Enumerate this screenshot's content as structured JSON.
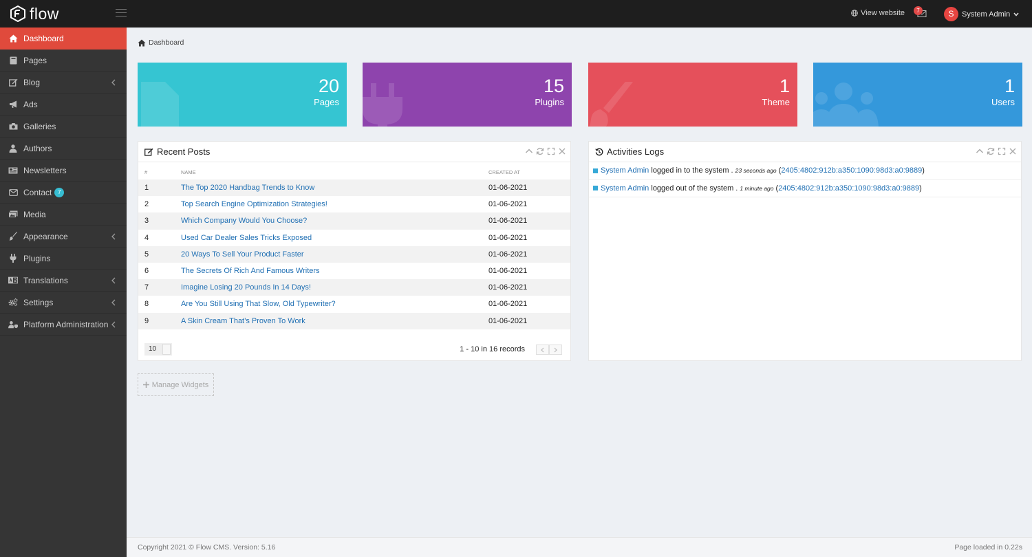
{
  "brand": {
    "name": "flow"
  },
  "topbar": {
    "view_website": "View website",
    "mail_badge": "7",
    "user_initial": "S",
    "user_name": "System Admin"
  },
  "sidebar": {
    "items": [
      {
        "label": "Dashboard",
        "icon": "home-icon",
        "active": true
      },
      {
        "label": "Pages",
        "icon": "book-icon"
      },
      {
        "label": "Blog",
        "icon": "edit-icon",
        "has_children": true
      },
      {
        "label": "Ads",
        "icon": "bullhorn-icon"
      },
      {
        "label": "Galleries",
        "icon": "camera-icon"
      },
      {
        "label": "Authors",
        "icon": "user-tie-icon"
      },
      {
        "label": "Newsletters",
        "icon": "newspaper-icon"
      },
      {
        "label": "Contact",
        "icon": "envelope-icon",
        "badge": "7"
      },
      {
        "label": "Media",
        "icon": "images-icon"
      },
      {
        "label": "Appearance",
        "icon": "paint-brush-icon",
        "has_children": true
      },
      {
        "label": "Plugins",
        "icon": "plug-icon"
      },
      {
        "label": "Translations",
        "icon": "language-icon",
        "has_children": true
      },
      {
        "label": "Settings",
        "icon": "cogs-icon",
        "has_children": true
      },
      {
        "label": "Platform Administration",
        "icon": "user-shield-icon",
        "has_children": true
      }
    ]
  },
  "breadcrumb": {
    "current": "Dashboard"
  },
  "stats": [
    {
      "value": "20",
      "label": "Pages",
      "color": "#35c5d2"
    },
    {
      "value": "15",
      "label": "Plugins",
      "color": "#8e44ad"
    },
    {
      "value": "1",
      "label": "Theme",
      "color": "#e5505b"
    },
    {
      "value": "1",
      "label": "Users",
      "color": "#3498db"
    }
  ],
  "recent_posts": {
    "title": "Recent Posts",
    "columns": [
      "#",
      "NAME",
      "CREATED AT"
    ],
    "rows": [
      {
        "num": "1",
        "name": "The Top 2020 Handbag Trends to Know",
        "date": "01-06-2021"
      },
      {
        "num": "2",
        "name": "Top Search Engine Optimization Strategies!",
        "date": "01-06-2021"
      },
      {
        "num": "3",
        "name": "Which Company Would You Choose?",
        "date": "01-06-2021"
      },
      {
        "num": "4",
        "name": "Used Car Dealer Sales Tricks Exposed",
        "date": "01-06-2021"
      },
      {
        "num": "5",
        "name": "20 Ways To Sell Your Product Faster",
        "date": "01-06-2021"
      },
      {
        "num": "6",
        "name": "The Secrets Of Rich And Famous Writers",
        "date": "01-06-2021"
      },
      {
        "num": "7",
        "name": "Imagine Losing 20 Pounds In 14 Days!",
        "date": "01-06-2021"
      },
      {
        "num": "8",
        "name": "Are You Still Using That Slow, Old Typewriter?",
        "date": "01-06-2021"
      },
      {
        "num": "9",
        "name": "A Skin Cream That’s Proven To Work",
        "date": "01-06-2021"
      }
    ],
    "page_size": "10",
    "records": "1 - 10 in 16 records"
  },
  "activities": {
    "title": "Activities Logs",
    "rows": [
      {
        "user": "System Admin",
        "action": "logged in to the system",
        "time": "23 seconds ago",
        "ip": "2405:4802:912b:a350:1090:98d3:a0:9889"
      },
      {
        "user": "System Admin",
        "action": "logged out of the system",
        "time": "1 minute ago",
        "ip": "2405:4802:912b:a350:1090:98d3:a0:9889"
      }
    ]
  },
  "manage_widgets": "Manage Widgets",
  "footer": {
    "copyright": "Copyright 2021 © Flow CMS. Version: 5.16",
    "loaded": "Page loaded in 0.22s"
  }
}
